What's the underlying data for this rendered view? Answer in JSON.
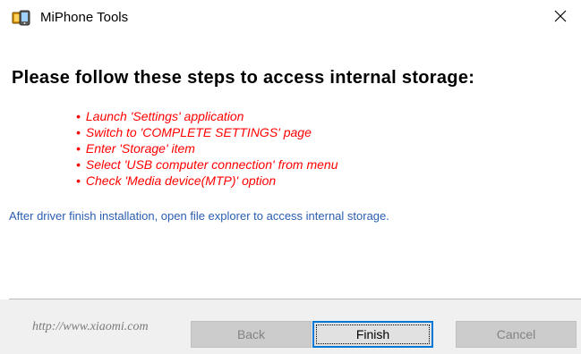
{
  "window": {
    "title": "MiPhone Tools",
    "app_icon": "miphone-app-icon",
    "close_icon": "close-icon"
  },
  "content": {
    "heading": "Please follow these steps to access internal storage:",
    "steps": [
      "Launch 'Settings' application",
      "Switch to 'COMPLETE SETTINGS' page",
      "Enter 'Storage' item",
      "Select 'USB computer connection' from menu",
      "Check 'Media device(MTP)' option"
    ],
    "info": "After driver finish installation, open file explorer to access internal storage."
  },
  "footer": {
    "url": "http://www.xiaomi.com",
    "back_label": "Back",
    "finish_label": "Finish",
    "cancel_label": "Cancel"
  },
  "colors": {
    "steps": "#ff0000",
    "info": "#2a5db0",
    "focus_border": "#0078d7"
  }
}
